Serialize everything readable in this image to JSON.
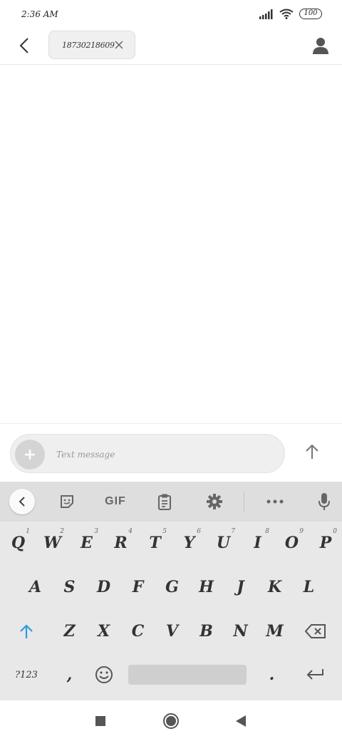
{
  "status_bar": {
    "time": "2:36 AM",
    "battery": "100"
  },
  "header": {
    "recipient": "18730218609",
    "icons": {
      "back": "back-icon",
      "chip_close": "close-icon",
      "contact": "person-icon"
    }
  },
  "compose": {
    "placeholder": "Text message",
    "icons": {
      "attach": "plus-icon",
      "send": "arrow-up-icon"
    }
  },
  "keyboard": {
    "toolbar": {
      "gif_label": "GIF",
      "icons": [
        "chevron-left-icon",
        "sticker-icon",
        "clipboard-icon",
        "gear-icon",
        "more-icon",
        "mic-icon"
      ]
    },
    "row1": [
      {
        "label": "Q",
        "hint": "1"
      },
      {
        "label": "W",
        "hint": "2"
      },
      {
        "label": "E",
        "hint": "3"
      },
      {
        "label": "R",
        "hint": "4"
      },
      {
        "label": "T",
        "hint": "5"
      },
      {
        "label": "Y",
        "hint": "6"
      },
      {
        "label": "U",
        "hint": "7"
      },
      {
        "label": "I",
        "hint": "8"
      },
      {
        "label": "O",
        "hint": "9"
      },
      {
        "label": "P",
        "hint": "0"
      }
    ],
    "row2": [
      "A",
      "S",
      "D",
      "F",
      "G",
      "H",
      "J",
      "K",
      "L"
    ],
    "row3": [
      "Z",
      "X",
      "C",
      "V",
      "B",
      "N",
      "M"
    ],
    "row4": {
      "symbols": "?123",
      "comma": ",",
      "period": "."
    }
  },
  "colors": {
    "shift_accent": "#2e9be0"
  }
}
